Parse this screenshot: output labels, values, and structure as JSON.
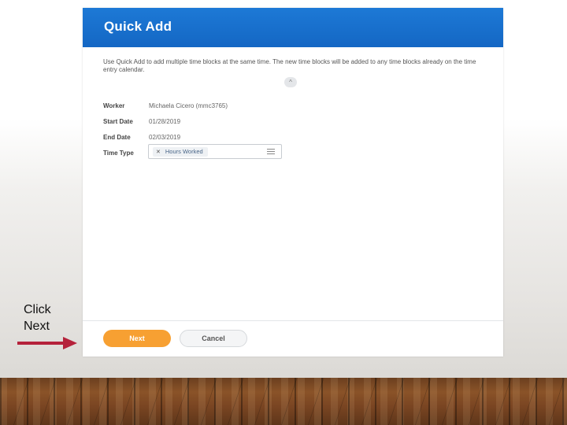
{
  "dialog": {
    "title": "Quick Add",
    "intro": "Use Quick Add to add multiple time blocks at the same time. The new time blocks will be added to any time blocks already on the time entry calendar.",
    "collapse_icon": "chevron-up-icon",
    "fields": [
      {
        "label": "Worker",
        "value": "Michaela Cicero (mmc3765)"
      },
      {
        "label": "Start Date",
        "value": "01/28/2019"
      },
      {
        "label": "End Date",
        "value": "02/03/2019"
      }
    ],
    "time_type": {
      "label": "Time Type",
      "selected": "Hours Worked",
      "remove_icon": "x-icon",
      "picker_icon": "list-icon"
    },
    "buttons": {
      "next": "Next",
      "cancel": "Cancel"
    }
  },
  "annotation": {
    "line1": "Click",
    "line2": "Next",
    "arrow_color": "#b5223b"
  },
  "colors": {
    "header": "#1467c4",
    "next_button": "#f7a032"
  }
}
